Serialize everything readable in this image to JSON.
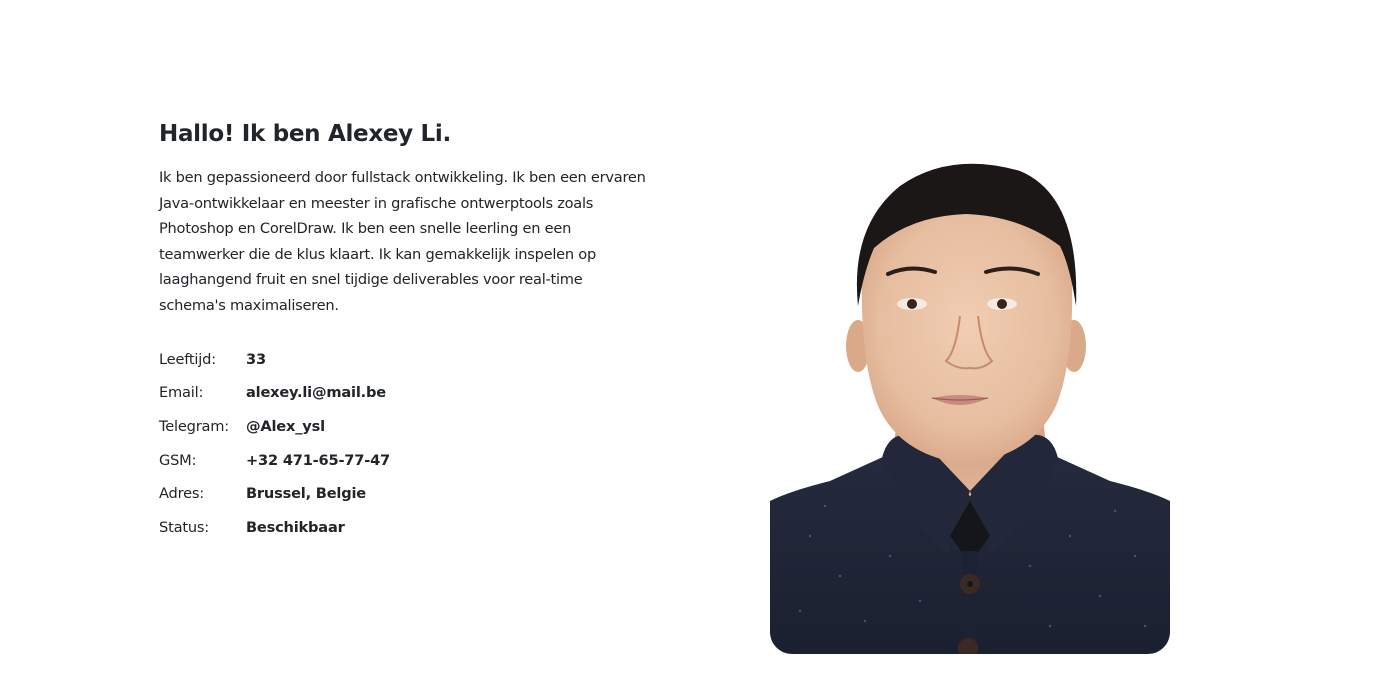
{
  "about": {
    "heading": "Hallo! Ik ben Alexey Li.",
    "paragraph_lines": [
      "Ik ben gepassioneerd door fullstack ontwikkeling. Ik ben een ervaren",
      "Java-ontwikkelaar en meester in grafische ontwerptools zoals",
      "Photoshop en CorelDraw. Ik ben een snelle leerling en een",
      "teamwerker die de klus klaart. Ik kan gemakkelijk inspelen op",
      "laaghangend fruit en snel tijdige deliverables voor real-time",
      "schema's maximaliseren."
    ],
    "info": [
      {
        "label": "Leeftijd:",
        "value": "33"
      },
      {
        "label": "Email:",
        "value": "alexey.li@mail.be"
      },
      {
        "label": "Telegram:",
        "value": "@Alex_ysl"
      },
      {
        "label": "GSM:",
        "value": "+32 471-65-77-47"
      },
      {
        "label": "Adres:",
        "value": "Brussel, Belgie"
      },
      {
        "label": "Status:",
        "value": "Beschikbaar"
      }
    ]
  },
  "portrait": {
    "icon": "person-portrait-photo",
    "colors": {
      "background": "#ffffff",
      "skin": "#e9c2a6",
      "hair": "#1b1716",
      "sweater": "#1d2333"
    }
  }
}
